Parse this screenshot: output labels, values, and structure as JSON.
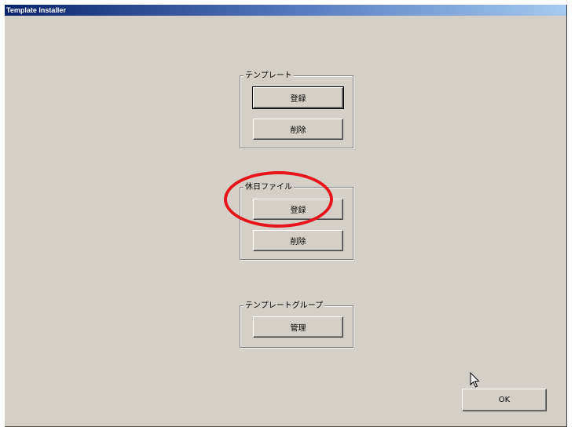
{
  "window": {
    "title": "Template Installer"
  },
  "groups": {
    "template": {
      "label": "テンプレート",
      "register_label": "登録",
      "delete_label": "削除"
    },
    "holiday_file": {
      "label": "休日ファイル",
      "register_label": "登録",
      "delete_label": "削除"
    },
    "template_group": {
      "label": "テンプレートグループ",
      "manage_label": "管理"
    }
  },
  "ok_label": "OK",
  "annotation": {
    "shape": "ellipse",
    "color": "#e8141c"
  },
  "icons": {
    "cursor": "mouse-pointer-icon"
  }
}
